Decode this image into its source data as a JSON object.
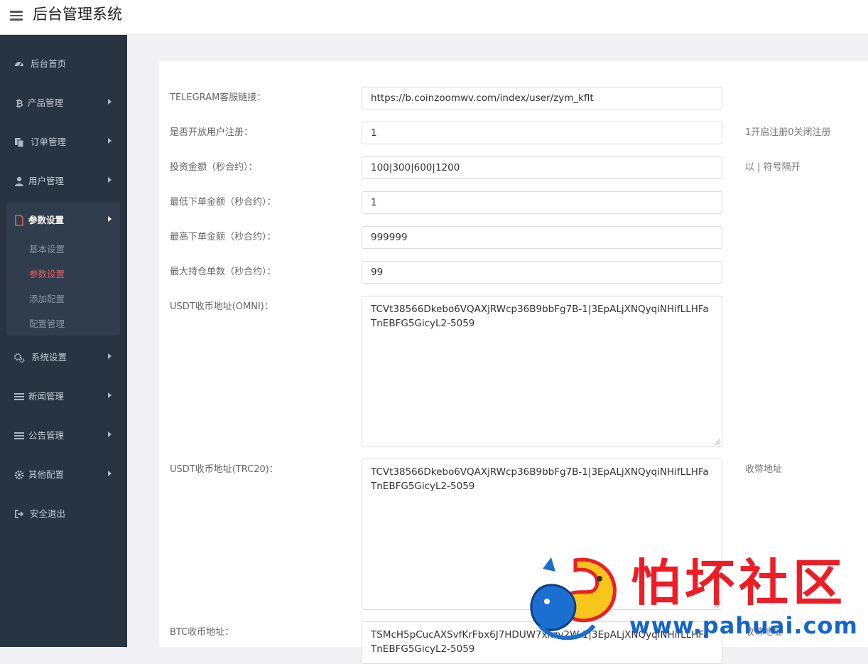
{
  "app": {
    "title": "后台管理系统"
  },
  "sidebar": {
    "items": [
      {
        "label": "后台首页",
        "icon": "dashboard-icon"
      },
      {
        "label": "产品管理",
        "icon": "bitcoin-icon"
      },
      {
        "label": "订单管理",
        "icon": "copy-icon"
      },
      {
        "label": "用户管理",
        "icon": "user-icon"
      },
      {
        "label": "参数设置",
        "icon": "file-icon"
      },
      {
        "label": "系统设置",
        "icon": "gears-icon"
      },
      {
        "label": "新闻管理",
        "icon": "list-icon"
      },
      {
        "label": "公告管理",
        "icon": "list-icon"
      },
      {
        "label": "其他配置",
        "icon": "gear-icon"
      },
      {
        "label": "安全退出",
        "icon": "signout-icon"
      }
    ],
    "subitems": [
      {
        "label": "基本设置"
      },
      {
        "label": "参数设置"
      },
      {
        "label": "添加配置"
      },
      {
        "label": "配置管理"
      }
    ]
  },
  "form": {
    "fields": [
      {
        "label": "TELEGRAM客服链接：",
        "value": "https://b.coinzoomwv.com/index/user/zym_kflt",
        "hint": ""
      },
      {
        "label": "是否开放用户注册：",
        "value": "1",
        "hint": "1开启注册0关闭注册"
      },
      {
        "label": "投资金额（秒合约）：",
        "value": "100|300|600|1200",
        "hint": "以 | 符号隔开"
      },
      {
        "label": "最低下单金额（秒合约）：",
        "value": "1",
        "hint": ""
      },
      {
        "label": "最高下单金额（秒合约）：",
        "value": "999999",
        "hint": ""
      },
      {
        "label": "最大持仓单数（秒合约）：",
        "value": "99",
        "hint": ""
      },
      {
        "label": "USDT收币地址(OMNI)：",
        "value": "TCVt38566Dkebo6VQAXjRWcp36B9bbFg7B-1|3EpALjXNQyqiNHifLLHFaTnEBFG5GicyL2-5059",
        "hint": ""
      },
      {
        "label": "USDT收币地址(TRC20)：",
        "value": "TCVt38566Dkebo6VQAXjRWcp36B9bbFg7B-1|3EpALjXNQyqiNHifLLHFaTnEBFG5GicyL2-5059",
        "hint": "收幣地址"
      },
      {
        "label": "BTC收币地址：",
        "value": "TSMcH5pCucAXSvfKrFbx6J7HDUW7xkzv2W-1|3EpALjXNQyqiNHifLLHFaTnEBFG5GicyL2-5059",
        "hint": "收幣地址"
      }
    ]
  },
  "watermark": {
    "text": "怕坏社区",
    "url": "www.pahuai.com"
  },
  "colors": {
    "sidebar_bg": "#283442",
    "active_sub": "#ee5b5b",
    "active_icon": "#e85a5a",
    "watermark_red": "#ee1c25",
    "watermark_blue": "#1565c8"
  }
}
